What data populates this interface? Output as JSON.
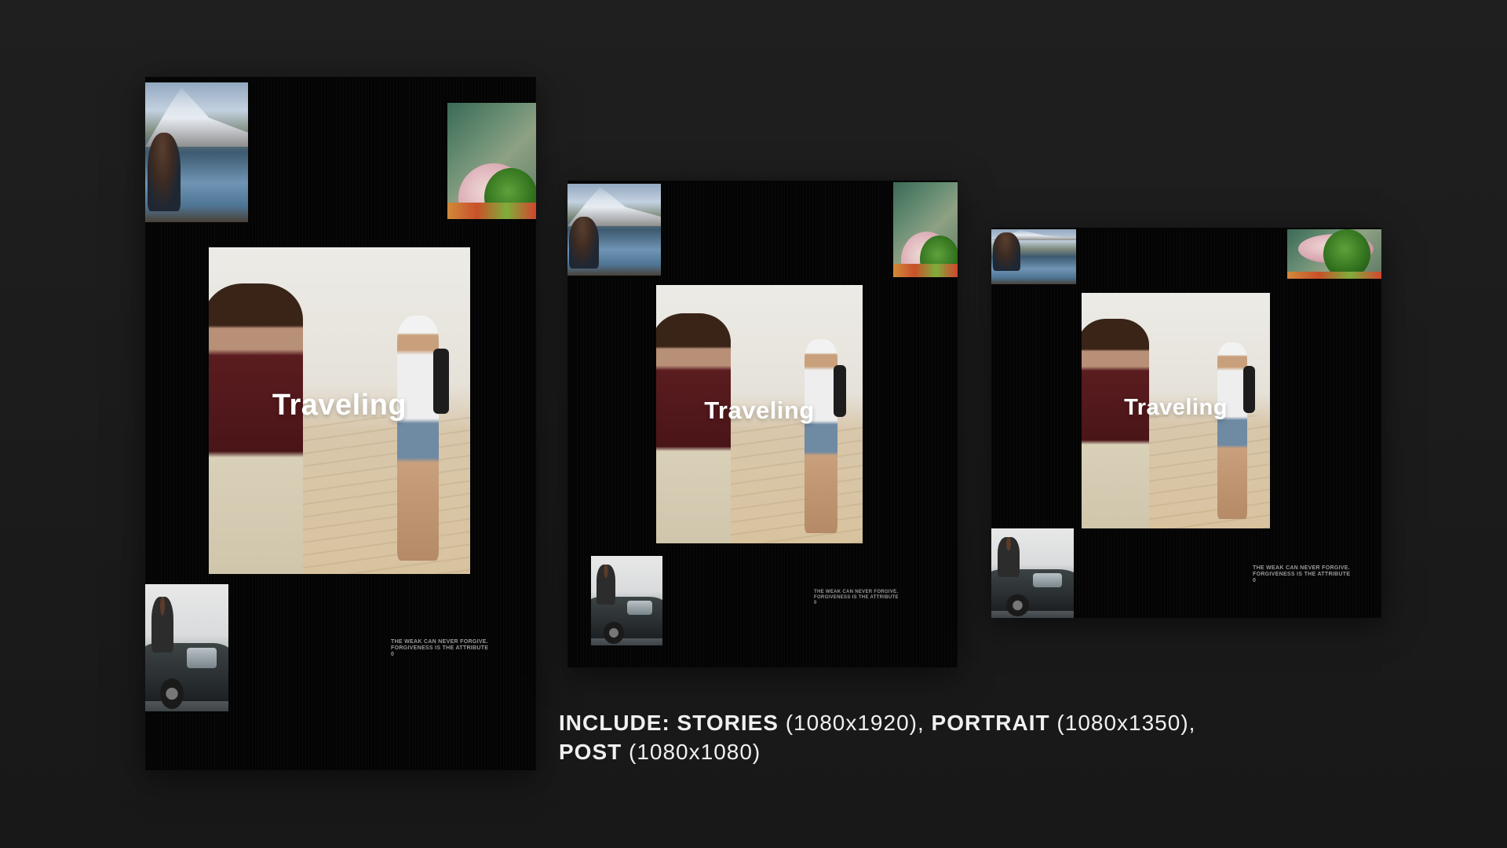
{
  "frames": {
    "stories": {
      "title": "Traveling",
      "quote_line1": "THE WEAK CAN NEVER FORGIVE.",
      "quote_line2": "FORGIVENESS IS THE ATTRIBUTE",
      "quote_line3": "0"
    },
    "portrait": {
      "title": "Traveling",
      "quote_line1": "THE WEAK CAN NEVER FORGIVE.",
      "quote_line2": "FORGIVENESS IS THE ATTRIBUTE",
      "quote_line3": "0"
    },
    "post": {
      "title": "Traveling",
      "quote_line1": "THE WEAK CAN NEVER FORGIVE.",
      "quote_line2": "FORGIVENESS IS THE ATTRIBUTE",
      "quote_line3": "0"
    }
  },
  "caption": {
    "include_label": "INCLUDE:",
    "stories_label": "STORIES",
    "stories_size": "(1080x1920),",
    "portrait_label": "PORTRAIT",
    "portrait_size": "(1080x1350),",
    "post_label": "POST",
    "post_size": "(1080x1080)"
  }
}
